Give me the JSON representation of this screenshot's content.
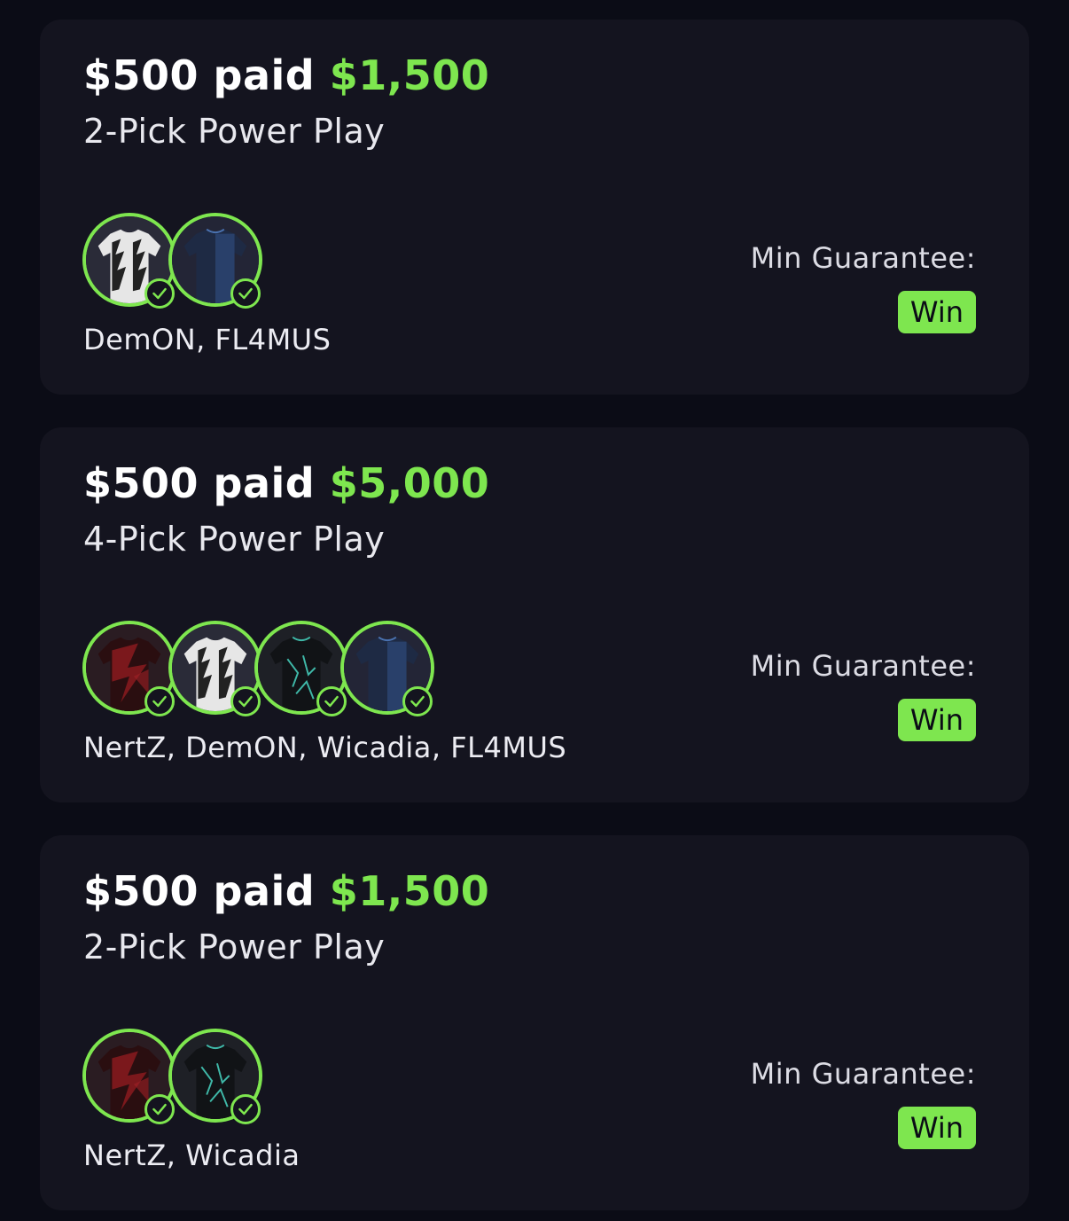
{
  "colors": {
    "background": "#0b0c16",
    "card": "#14141f",
    "accent_green": "#7ee64f",
    "text": "#ffffff"
  },
  "cards": [
    {
      "stake": "$500 paid",
      "payout": "$1,500",
      "play_type": "2-Pick Power Play",
      "players": "DemON, FL4MUS",
      "picks": [
        {
          "jersey": "white-black-striped-jersey-icon",
          "status": "check-icon"
        },
        {
          "jersey": "navy-blue-jersey-icon",
          "status": "check-icon"
        }
      ],
      "guarantee_label": "Min Guarantee:",
      "guarantee_value": "Win"
    },
    {
      "stake": "$500 paid",
      "payout": "$5,000",
      "play_type": "4-Pick Power Play",
      "players": "NertZ, DemON, Wicadia, FL4MUS",
      "picks": [
        {
          "jersey": "red-black-jersey-icon",
          "status": "check-icon"
        },
        {
          "jersey": "white-black-striped-jersey-icon",
          "status": "check-icon"
        },
        {
          "jersey": "black-teal-jersey-icon",
          "status": "check-icon"
        },
        {
          "jersey": "navy-blue-jersey-icon",
          "status": "check-icon"
        }
      ],
      "guarantee_label": "Min Guarantee:",
      "guarantee_value": "Win"
    },
    {
      "stake": "$500 paid",
      "payout": "$1,500",
      "play_type": "2-Pick Power Play",
      "players": "NertZ, Wicadia",
      "picks": [
        {
          "jersey": "red-black-jersey-icon",
          "status": "check-icon"
        },
        {
          "jersey": "black-teal-jersey-icon",
          "status": "check-icon"
        }
      ],
      "guarantee_label": "Min Guarantee:",
      "guarantee_value": "Win"
    }
  ]
}
